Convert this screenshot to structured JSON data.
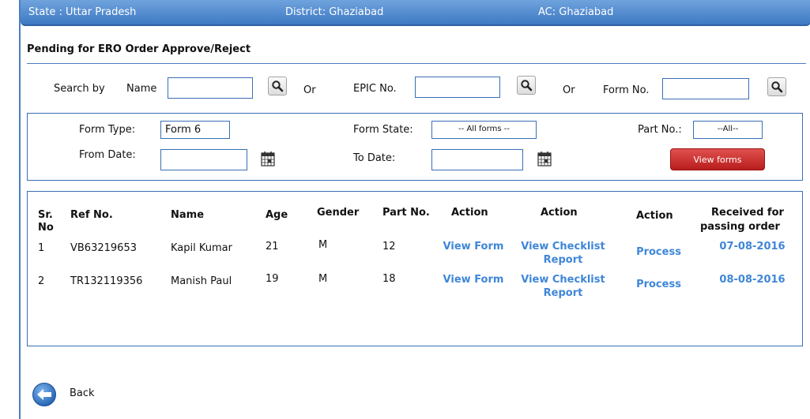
{
  "header": {
    "state": "State : Uttar Pradesh",
    "district": "District: Ghaziabad",
    "ac": "AC: Ghaziabad"
  },
  "page_title": "Pending for ERO Order Approve/Reject",
  "search": {
    "search_by_label": "Search by",
    "name_label": "Name",
    "or_1": "Or",
    "epic_label": "EPIC No.",
    "or_2": "Or",
    "form_no_label": "Form No.",
    "name_value": "",
    "epic_value": "",
    "form_no_value": ""
  },
  "filters": {
    "form_type_label": "Form Type:",
    "form_type_value": "Form 6",
    "form_state_label": "Form State:",
    "form_state_value": "-- All forms --",
    "part_no_label": "Part No.:",
    "part_no_value": "--All--",
    "from_date_label": "From Date:",
    "from_date_value": "",
    "to_date_label": "To Date:",
    "to_date_value": "",
    "view_forms_label": "View forms"
  },
  "table": {
    "headers": {
      "sr": "Sr.",
      "sr2": "No",
      "ref": "Ref No.",
      "name": "Name",
      "age": "Age",
      "gender": "Gender",
      "part": "Part No.",
      "action1": "Action",
      "action2": "Action",
      "action3": "Action",
      "received1": "Received for",
      "received2": "passing order"
    },
    "rows": [
      {
        "sr": "1",
        "ref": "VB63219653",
        "name": "Kapil Kumar",
        "age": "21",
        "gender": "M",
        "part": "12",
        "view_form": "View Form",
        "checklist1": "View Checklist",
        "checklist2": "Report",
        "process": "Process",
        "date": "07-08-2016"
      },
      {
        "sr": "2",
        "ref": "TR132119356",
        "name": "Manish Paul",
        "age": "19",
        "gender": "M",
        "part": "18",
        "view_form": "View Form",
        "checklist1": "View Checklist",
        "checklist2": "Report",
        "process": "Process",
        "date": "08-08-2016"
      }
    ]
  },
  "back_label": "Back",
  "colors": {
    "accent": "#3a6eb5",
    "link": "#3f86d8",
    "button_red": "#c62828"
  }
}
